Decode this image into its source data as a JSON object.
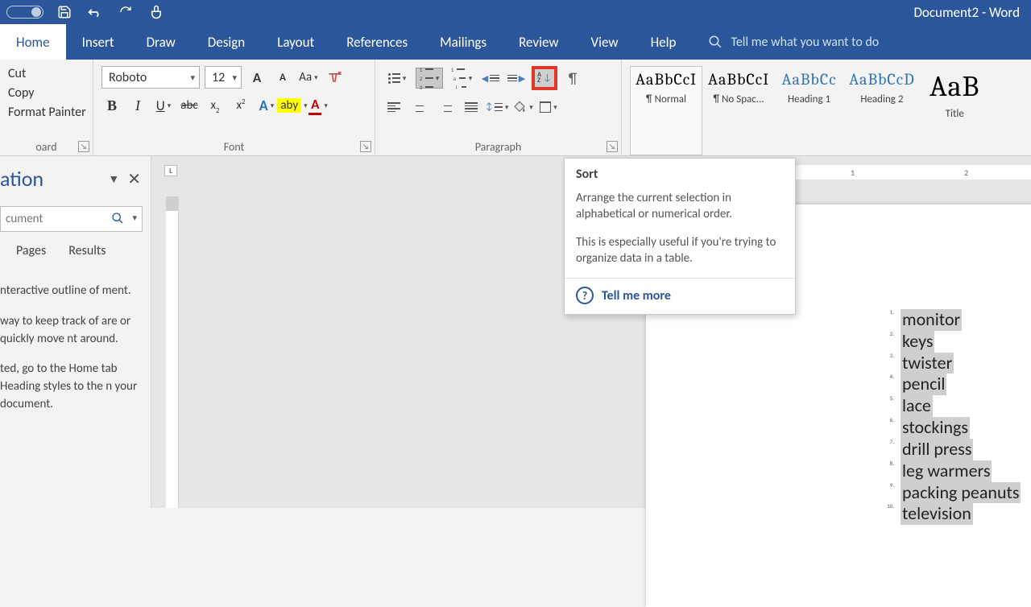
{
  "title": "Document2 - Word",
  "tabs": [
    "Home",
    "Insert",
    "Draw",
    "Design",
    "Layout",
    "References",
    "Mailings",
    "Review",
    "View",
    "Help"
  ],
  "active_tab": "Home",
  "tellme_placeholder": "Tell me what you want to do",
  "clipboard": {
    "cut": "Cut",
    "copy": "Copy",
    "painter": "Format Painter",
    "label": "oard"
  },
  "font": {
    "name": "Roboto",
    "size": "12",
    "label": "Font",
    "bold": "B",
    "italic": "I",
    "underline": "U",
    "strike": "abc",
    "sub": "x",
    "sup": "x",
    "textfx": "A",
    "highlight": "aby",
    "fontcolor": "A",
    "grow": "A",
    "shrink": "A",
    "case": "Aa"
  },
  "paragraph": {
    "label": "Paragraph",
    "sort_az": {
      "a": "A",
      "z": "Z"
    },
    "pilcrow": "¶"
  },
  "styles": [
    {
      "preview": "AaBbCcI",
      "name": "¶ Normal",
      "sel": true,
      "cls": ""
    },
    {
      "preview": "AaBbCcI",
      "name": "¶ No Spac...",
      "sel": false,
      "cls": ""
    },
    {
      "preview": "AaBbCc",
      "name": "Heading 1",
      "sel": false,
      "cls": "style-heading"
    },
    {
      "preview": "AaBbCcD",
      "name": "Heading 2",
      "sel": false,
      "cls": "style-heading"
    },
    {
      "preview": "AaB",
      "name": "Title",
      "sel": false,
      "cls": "style-title"
    }
  ],
  "nav": {
    "title": "ation",
    "search_placeholder": "cument",
    "tabs": {
      "pages": "Pages",
      "results": "Results"
    },
    "p1": "nteractive outline of ment.",
    "p2": "way to keep track of are or quickly move nt around.",
    "p3": "ted, go to the Home tab Heading styles to the n your document."
  },
  "tooltip": {
    "title": "Sort",
    "body1": "Arrange the current selection in alphabetical or numerical order.",
    "body2": "This is especially useful if you're trying to organize data in a table.",
    "more": "Tell me more"
  },
  "ruler": {
    "n1": "1",
    "n2": "2"
  },
  "ruler_corner": "L",
  "list": [
    "monitor",
    "keys",
    "twister",
    "pencil",
    "lace",
    "stockings",
    "drill press",
    "leg warmers",
    "packing peanuts",
    "television"
  ]
}
